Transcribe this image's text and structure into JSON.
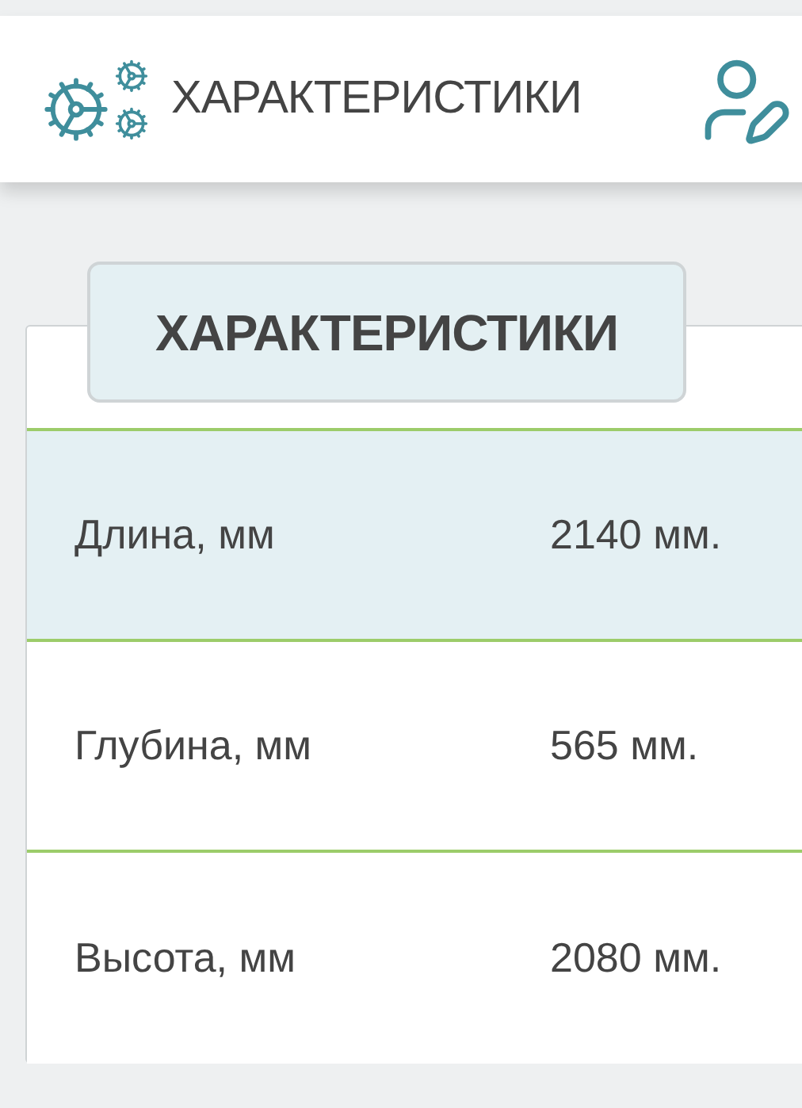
{
  "nav": {
    "label": "ХАРАКТЕРИСТИКИ"
  },
  "card": {
    "title": "ХАРАКТЕРИСТИКИ",
    "rows": [
      {
        "name": "Длина, мм",
        "value": "2140 мм.",
        "shaded": true
      },
      {
        "name": "Глубина, мм",
        "value": "565 мм.",
        "shaded": false
      },
      {
        "name": "Высота, мм",
        "value": "2080 мм.",
        "shaded": false
      }
    ]
  }
}
